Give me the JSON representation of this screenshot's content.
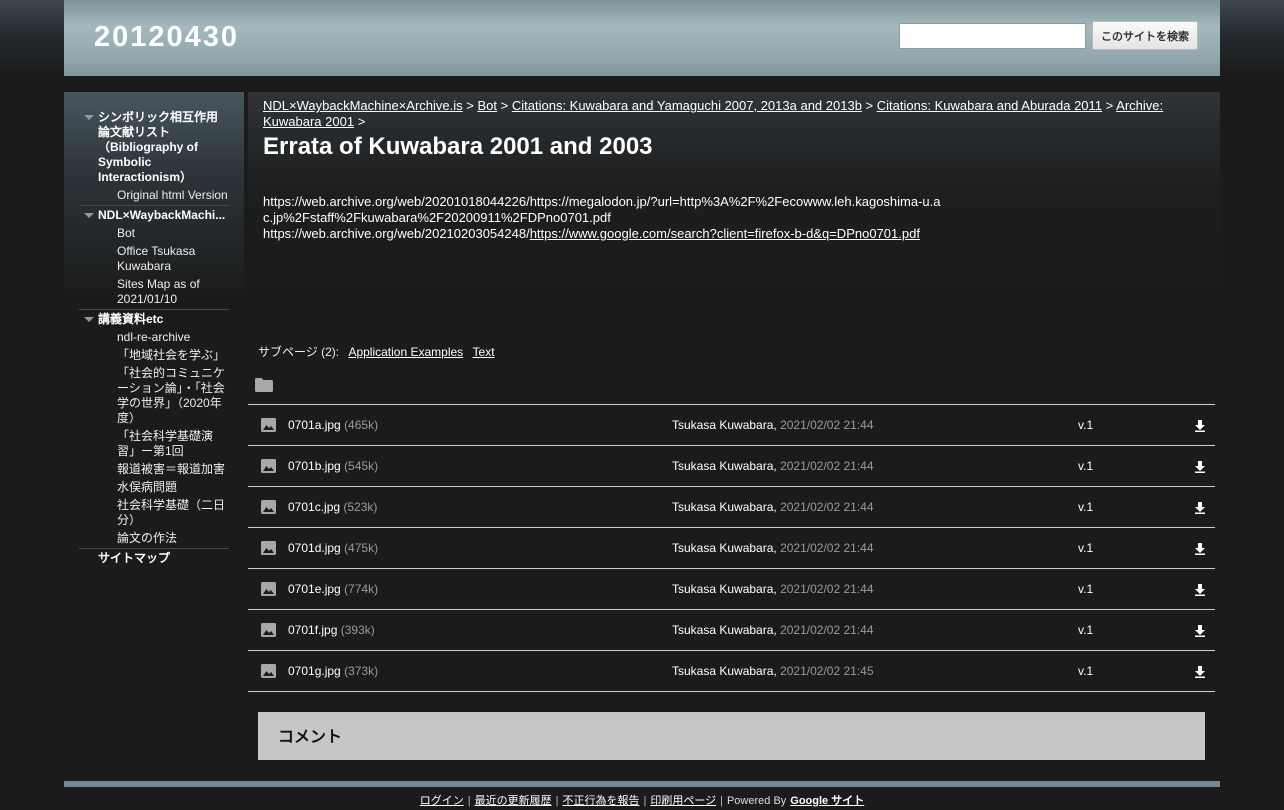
{
  "header": {
    "site_title": "20120430",
    "search_placeholder": "",
    "search_button": "このサイトを検索"
  },
  "sidebar": {
    "groups": [
      {
        "title": "シンボリック相互作用論文献リスト（Bibliography of Symbolic Interactionism）",
        "items": [
          "Original html Version"
        ]
      },
      {
        "title": "NDL×WaybackMachi...",
        "items": [
          "Bot",
          "Office Tsukasa Kuwabara",
          "Sites Map as of 2021/01/10"
        ]
      },
      {
        "title": "講義資料etc",
        "items": [
          "ndl-re-archive",
          "「地域社会を学ぶ」",
          "「社会的コミュニケーション論」・「社会学の世界」（2020年度）",
          "「社会科学基礎演習」ー第1回",
          "報道被害＝報道加害",
          "水俣病問題",
          "社会科学基礎（二日分）",
          "論文の作法"
        ]
      }
    ],
    "sitemap": "サイトマップ"
  },
  "breadcrumb": {
    "items": [
      "NDL×WaybackMachine×Archive.is",
      "Bot",
      "Citations: Kuwabara and Yamaguchi 2007, 2013a and 2013b",
      "Citations: Kuwabara and Aburada 2011",
      "Archive: Kuwabara 2001"
    ],
    "separator": ">"
  },
  "page": {
    "title": "Errata of Kuwabara 2001 and 2003",
    "line1": "https://web.archive.org/web/20201018044226/https://megalodon.jp/?url=http%3A%2F%2Fecowww.leh.kagoshima-u.ac.jp%2Fstaff%2Fkuwabara%2F20200911%2FDPno0701.pdf",
    "line2_prefix": "https://web.archive.org/web/20210203054248/",
    "line2_link": "https://www.google.com/search?client=firefox-b-d&q=DPno0701.pdf"
  },
  "subpages": {
    "label": "サブページ (2):",
    "links": [
      "Application Examples",
      "Text"
    ]
  },
  "attachments": [
    {
      "name": "0701a.jpg",
      "size": "(465k)",
      "author": "Tsukasa Kuwabara,",
      "date": "2021/02/02 21:44",
      "version": "v.1"
    },
    {
      "name": "0701b.jpg",
      "size": "(545k)",
      "author": "Tsukasa Kuwabara,",
      "date": "2021/02/02 21:44",
      "version": "v.1"
    },
    {
      "name": "0701c.jpg",
      "size": "(523k)",
      "author": "Tsukasa Kuwabara,",
      "date": "2021/02/02 21:44",
      "version": "v.1"
    },
    {
      "name": "0701d.jpg",
      "size": "(475k)",
      "author": "Tsukasa Kuwabara,",
      "date": "2021/02/02 21:44",
      "version": "v.1"
    },
    {
      "name": "0701e.jpg",
      "size": "(774k)",
      "author": "Tsukasa Kuwabara,",
      "date": "2021/02/02 21:44",
      "version": "v.1"
    },
    {
      "name": "0701f.jpg",
      "size": "(393k)",
      "author": "Tsukasa Kuwabara,",
      "date": "2021/02/02 21:44",
      "version": "v.1"
    },
    {
      "name": "0701g.jpg",
      "size": "(373k)",
      "author": "Tsukasa Kuwabara,",
      "date": "2021/02/02 21:45",
      "version": "v.1"
    }
  ],
  "comments": {
    "title": "コメント"
  },
  "footer": {
    "links": [
      "ログイン",
      "最近の更新履歴",
      "不正行為を報告",
      "印刷用ページ"
    ],
    "powered_by": "Powered By",
    "google_sites": "Google サイト"
  },
  "icons": {
    "folder": "folder-icon",
    "image": "image-file-icon",
    "download": "download-icon",
    "expand": "triangle-down-icon"
  }
}
